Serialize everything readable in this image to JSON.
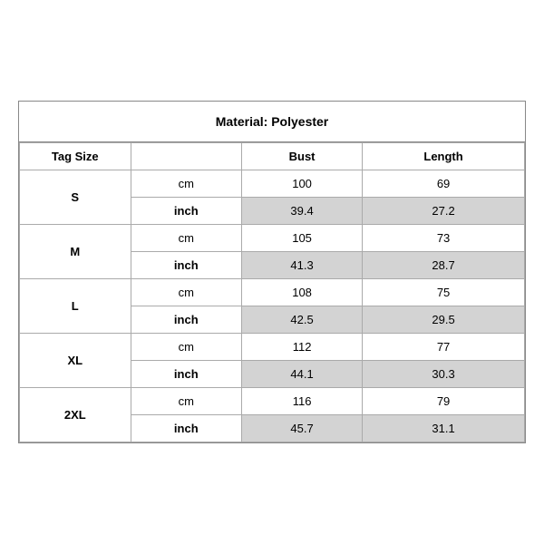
{
  "title": "Material: Polyester",
  "header": {
    "tag_size": "Tag Size",
    "bust": "Bust",
    "length": "Length"
  },
  "sizes": [
    {
      "tag": "S",
      "cm": {
        "bust": "100",
        "length": "69"
      },
      "inch": {
        "bust": "39.4",
        "length": "27.2"
      }
    },
    {
      "tag": "M",
      "cm": {
        "bust": "105",
        "length": "73"
      },
      "inch": {
        "bust": "41.3",
        "length": "28.7"
      }
    },
    {
      "tag": "L",
      "cm": {
        "bust": "108",
        "length": "75"
      },
      "inch": {
        "bust": "42.5",
        "length": "29.5"
      }
    },
    {
      "tag": "XL",
      "cm": {
        "bust": "112",
        "length": "77"
      },
      "inch": {
        "bust": "44.1",
        "length": "30.3"
      }
    },
    {
      "tag": "2XL",
      "cm": {
        "bust": "116",
        "length": "79"
      },
      "inch": {
        "bust": "45.7",
        "length": "31.1"
      }
    }
  ],
  "units": {
    "cm": "cm",
    "inch": "inch"
  }
}
